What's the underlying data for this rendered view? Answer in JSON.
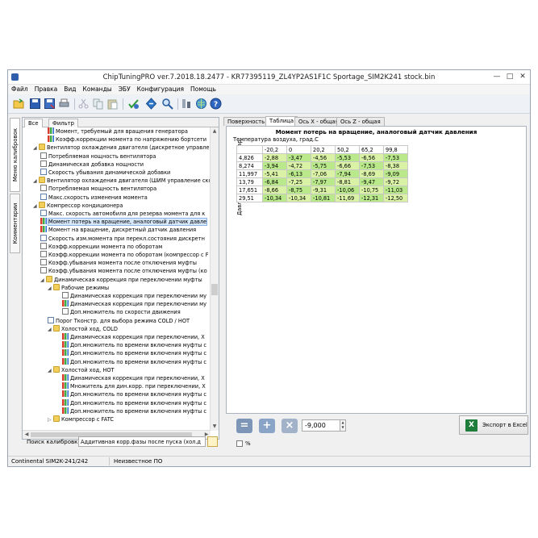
{
  "window": {
    "title": "ChipTuningPRO ver.7.2018.18.2477 - KR77395119_ZL4YP2AS1F1C Sportage_SIM2K241 stock.bin",
    "controls": {
      "minimize": "—",
      "maximize": "□",
      "close": "✕"
    }
  },
  "menu": [
    "Файл",
    "Правка",
    "Вид",
    "Команды",
    "ЭБУ",
    "Конфигурация",
    "Помощь"
  ],
  "toolbar": {
    "icons": [
      "open-folder-icon",
      "save-icon",
      "save-as-icon",
      "print-icon",
      "cut-icon",
      "copy-icon",
      "paste-icon",
      "checksum-icon",
      "navigate-icon",
      "search-icon",
      "compare-icon",
      "globe-icon",
      "help-icon"
    ]
  },
  "side_tabs": [
    "Меню калибровок",
    "Комментарии"
  ],
  "tree": {
    "tabs": [
      "Все",
      "Фильтр"
    ],
    "rows": [
      {
        "indent": 3,
        "icon": "bar",
        "text": "Момент, требуемый для вращения генератора"
      },
      {
        "indent": 3,
        "icon": "bar",
        "text": "Коэфф.коррекции момента по напряжению бортсети"
      },
      {
        "indent": 1,
        "icon": "folder",
        "arrow": "◢",
        "text": "Вентилятор охлаждения двигателя (дискретное управлен"
      },
      {
        "indent": 2,
        "icon": "curve",
        "text": "Потребляемая нощность вентилятора"
      },
      {
        "indent": 2,
        "icon": "curve",
        "text": "Динамическая добавка нощности"
      },
      {
        "indent": 2,
        "icon": "const",
        "text": "Скорость убывания динамической добавки"
      },
      {
        "indent": 1,
        "icon": "folder",
        "arrow": "◢",
        "text": "Вентилятор охлаждения двигателя (ШИМ управление скор"
      },
      {
        "indent": 2,
        "icon": "curve",
        "text": "Потребляемая мощность вентилятора"
      },
      {
        "indent": 2,
        "icon": "const",
        "text": "Макс.скорость изменения момента"
      },
      {
        "indent": 1,
        "icon": "folder",
        "arrow": "◢",
        "text": "Компрессор кондиционера"
      },
      {
        "indent": 2,
        "icon": "const",
        "text": "Макс. скорость автомобиля для резерва момента для к"
      },
      {
        "indent": 2,
        "icon": "bar",
        "text": "Момент потерь на вращение, аналоговый датчик давле",
        "selected": true
      },
      {
        "indent": 2,
        "icon": "bar",
        "text": "Момент на вращение, дискретный датчик давления"
      },
      {
        "indent": 2,
        "icon": "const",
        "text": "Скорость изм.момента при перекл.состояния дискретн"
      },
      {
        "indent": 2,
        "icon": "curve",
        "text": "Коэфф.коррекции момента по оборотам"
      },
      {
        "indent": 2,
        "icon": "curve",
        "text": "Коэфф.коррекции момента по оборотам (компрессор с F"
      },
      {
        "indent": 2,
        "icon": "curve",
        "text": "Коэфф.убывания момента после отключения муфты"
      },
      {
        "indent": 2,
        "icon": "curve",
        "text": "Коэфф.убывания момента после отключения муфты (ко"
      },
      {
        "indent": 2,
        "icon": "folder",
        "arrow": "◢",
        "text": "Динамическая коррекция при переключении муфты"
      },
      {
        "indent": 3,
        "icon": "folder",
        "arrow": "◢",
        "text": "Рабочие режимы"
      },
      {
        "indent": 5,
        "icon": "curve",
        "text": "Динамическая коррекция при переключении му"
      },
      {
        "indent": 5,
        "icon": "bar",
        "text": "Динамическая коррекция при переключении му"
      },
      {
        "indent": 5,
        "icon": "curve",
        "text": "Доп.множитель по скорости движения"
      },
      {
        "indent": 3,
        "icon": "const",
        "text": "Порог Тконстр. для выбора режима COLD / HOT"
      },
      {
        "indent": 3,
        "icon": "folder",
        "arrow": "◢",
        "text": "Холостой ход, COLD"
      },
      {
        "indent": 5,
        "icon": "bar",
        "text": "Динамическая коррекция при переключении, Х"
      },
      {
        "indent": 5,
        "icon": "bar",
        "text": "Доп.множитель по времени включения муфты с"
      },
      {
        "indent": 5,
        "icon": "bar",
        "text": "Доп.множитель по времени включения муфты с"
      },
      {
        "indent": 5,
        "icon": "bar",
        "text": "Доп.множитель по времени включения муфты с"
      },
      {
        "indent": 3,
        "icon": "folder",
        "arrow": "◢",
        "text": "Холостой ход, HOT"
      },
      {
        "indent": 5,
        "icon": "bar",
        "text": "Динамическая коррекция при переключении, Х"
      },
      {
        "indent": 5,
        "icon": "bar",
        "text": "Множитель для дин.корр. при переключении, Х"
      },
      {
        "indent": 5,
        "icon": "bar",
        "text": "Доп.множитель по времени включения муфты с"
      },
      {
        "indent": 5,
        "icon": "bar",
        "text": "Доп.множитель по времени включения муфты с"
      },
      {
        "indent": 5,
        "icon": "bar",
        "text": "Доп.множитель по времени включения муфты с"
      },
      {
        "indent": 3,
        "icon": "folder",
        "arrow": "▷",
        "text": "Компрессор с FATC"
      }
    ]
  },
  "search": {
    "label": "Поиск калибровки",
    "value": "Аддитивная корр.фазы после пуска (хол.д"
  },
  "right_tabs": [
    "Поверхность",
    "Таблица",
    "Ось X - общая",
    "Ось Z - общая"
  ],
  "map": {
    "title": "Момент потерь на вращение, аналоговый датчик давления",
    "x_axis_label": "Температура воздуха, град.С",
    "y_axis_label": "Давление хладагента, Бар",
    "x_headers": [
      "-20,2",
      "0",
      "20,2",
      "50,2",
      "65,2",
      "99,8"
    ],
    "rows": [
      {
        "y": "4,826",
        "values": [
          "-2,88",
          "-3,47",
          "-4,56",
          "-5,53",
          "-6,56",
          "-7,53"
        ]
      },
      {
        "y": "8,274",
        "values": [
          "-3,94",
          "-4,72",
          "-5,75",
          "-6,66",
          "-7,53",
          "-8,38"
        ]
      },
      {
        "y": "11,997",
        "values": [
          "-5,41",
          "-6,13",
          "-7,06",
          "-7,94",
          "-8,69",
          "-9,09"
        ]
      },
      {
        "y": "13,79",
        "values": [
          "-6,84",
          "-7,25",
          "-7,97",
          "-8,81",
          "-9,47",
          "-9,72"
        ]
      },
      {
        "y": "17,651",
        "values": [
          "-8,66",
          "-8,75",
          "-9,31",
          "-10,06",
          "-10,75",
          "-11,03"
        ]
      },
      {
        "y": "29,51",
        "values": [
          "-10,34",
          "-10,34",
          "-10,81",
          "-11,69",
          "-12,31",
          "-12,50"
        ]
      }
    ]
  },
  "bottom": {
    "value": "-9,000",
    "percent_label": "%",
    "excel_label": "Экспорт в Excel"
  },
  "status": {
    "ecu": "Continental SIM2K-241/242",
    "software": "Неизвестное ПО"
  }
}
